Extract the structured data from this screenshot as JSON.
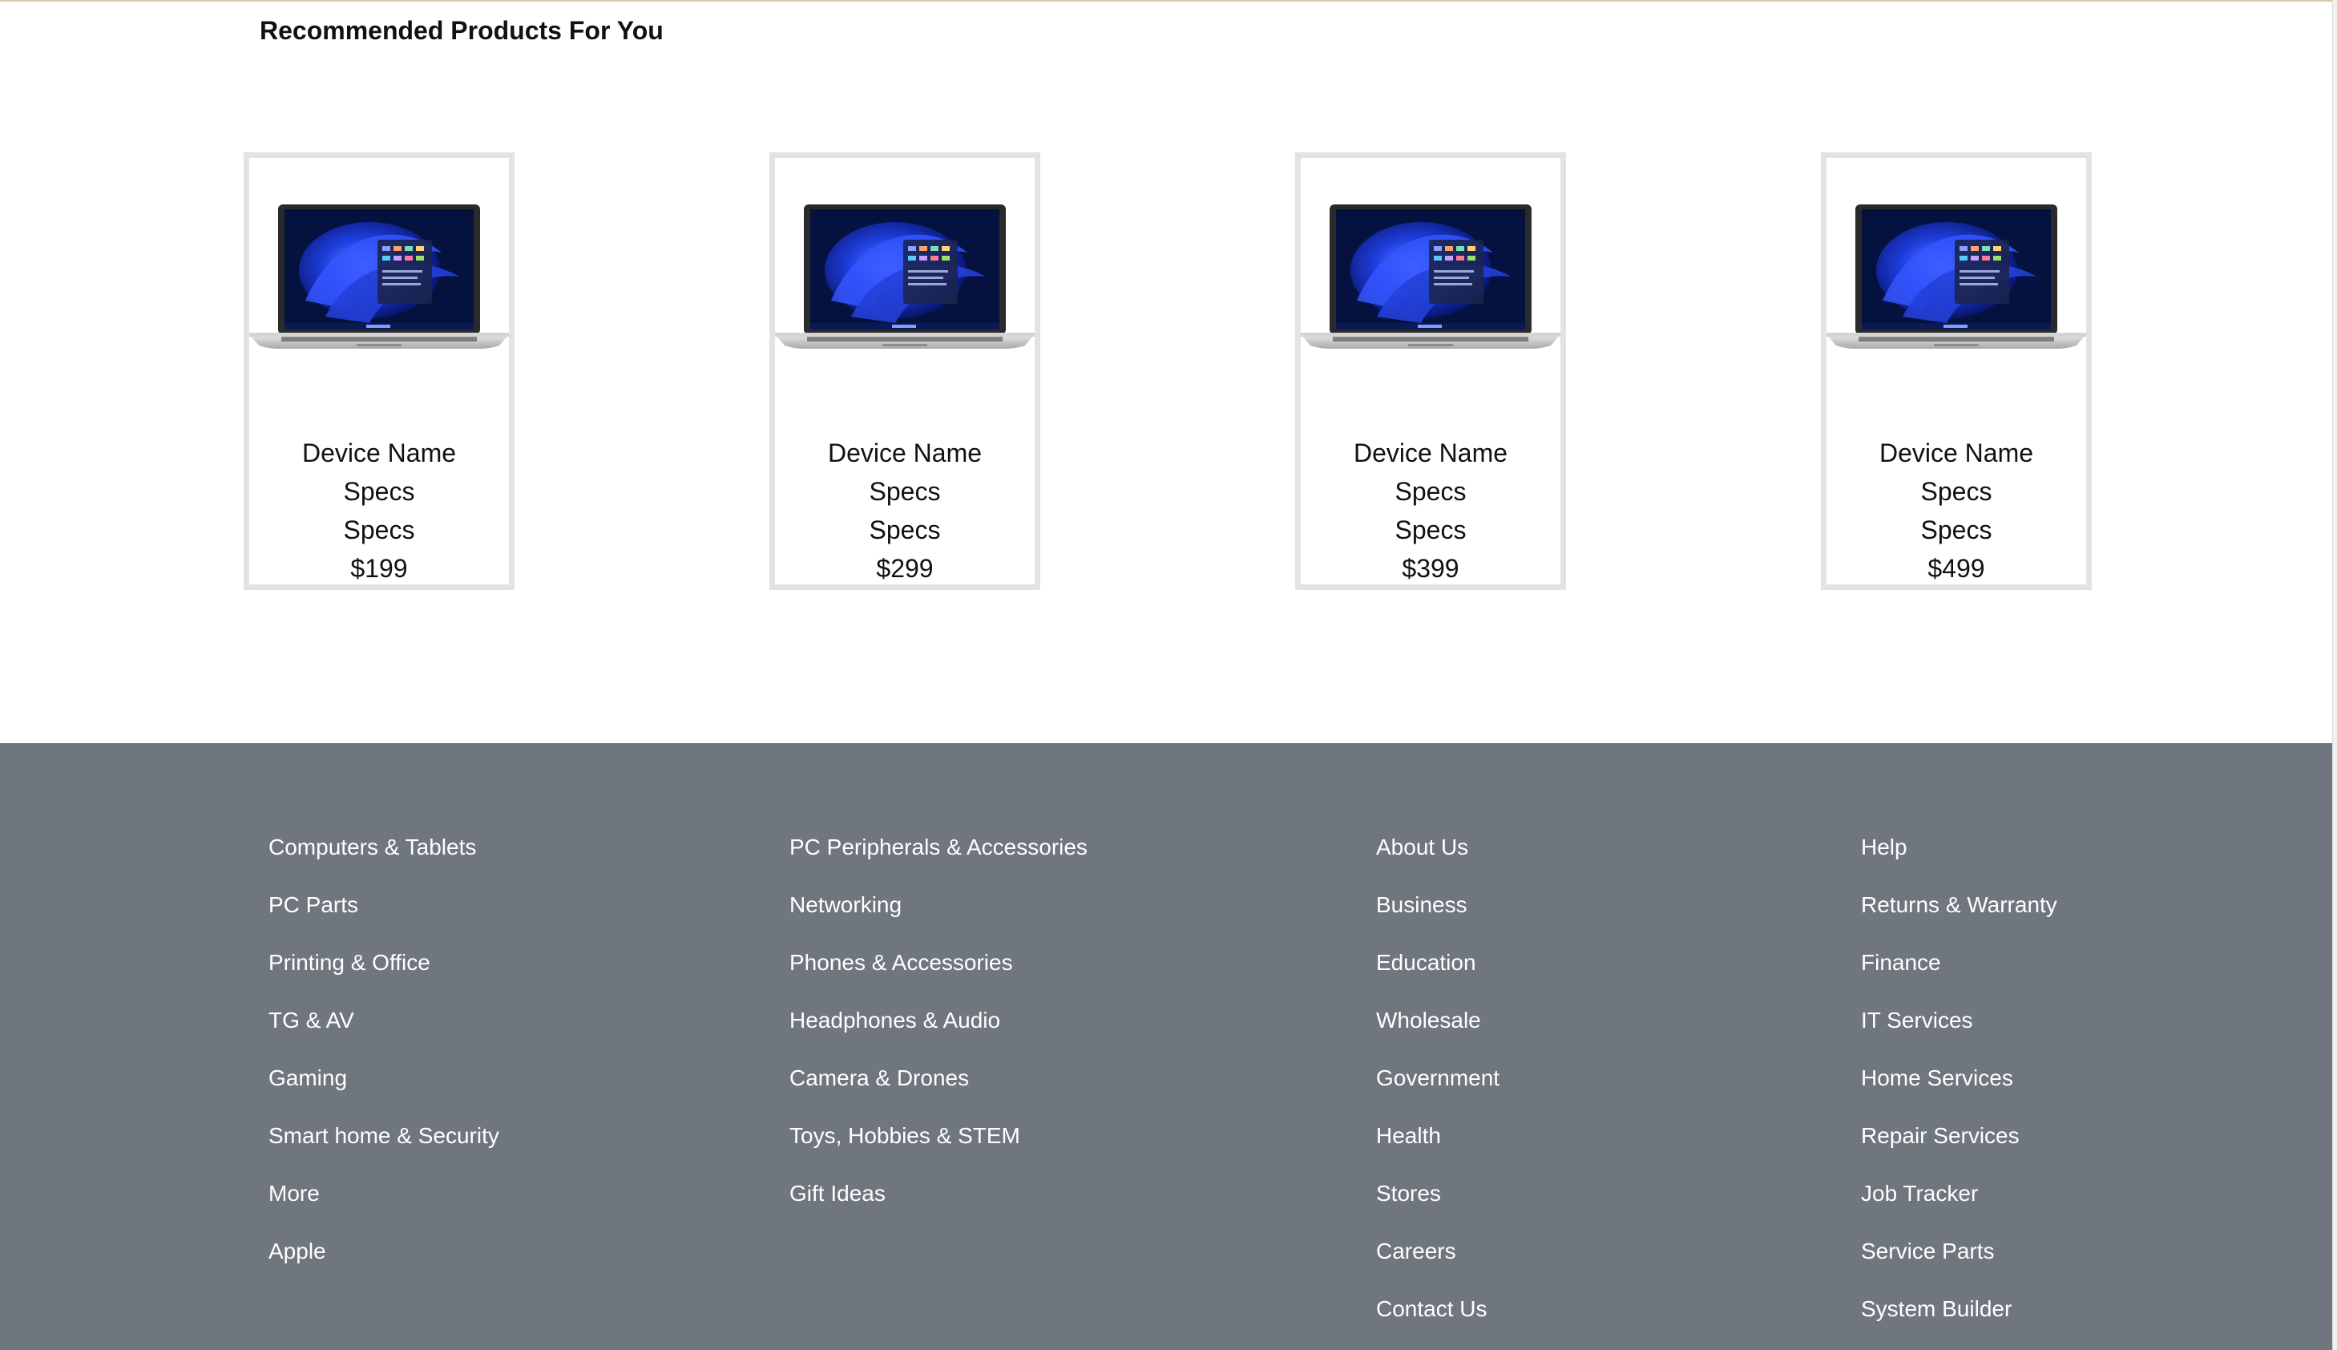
{
  "recommendations": {
    "title": "Recommended Products For You",
    "products": [
      {
        "name": "Device Name",
        "spec1": "Specs",
        "spec2": "Specs",
        "price": "$199",
        "image": "laptop-image"
      },
      {
        "name": "Device Name",
        "spec1": "Specs",
        "spec2": "Specs",
        "price": "$299",
        "image": "laptop-image"
      },
      {
        "name": "Device Name",
        "spec1": "Specs",
        "spec2": "Specs",
        "price": "$399",
        "image": "laptop-image"
      },
      {
        "name": "Device Name",
        "spec1": "Specs",
        "spec2": "Specs",
        "price": "$499",
        "image": "laptop-image"
      }
    ]
  },
  "footer": {
    "columns": [
      {
        "links": [
          "Computers & Tablets",
          "PC Parts",
          "Printing & Office",
          "TG & AV",
          "Gaming",
          "Smart home & Security",
          "More",
          "Apple"
        ]
      },
      {
        "links": [
          "PC Peripherals & Accessories",
          "Networking",
          "Phones & Accessories",
          "Headphones & Audio",
          "Camera & Drones",
          "Toys, Hobbies & STEM",
          "Gift Ideas"
        ]
      },
      {
        "links": [
          "About Us",
          "Business",
          "Education",
          "Wholesale",
          "Government",
          "Health",
          "Stores",
          "Careers",
          "Contact Us"
        ]
      },
      {
        "links": [
          "Help",
          "Returns & Warranty",
          "Finance",
          "IT Services",
          "Home Services",
          "Repair Services",
          "Job Tracker",
          "Service Parts",
          "System Builder"
        ]
      }
    ]
  },
  "colors": {
    "footer_bg": "#70767e",
    "card_border": "#e3e3e3",
    "footer_text": "#ffffff"
  }
}
